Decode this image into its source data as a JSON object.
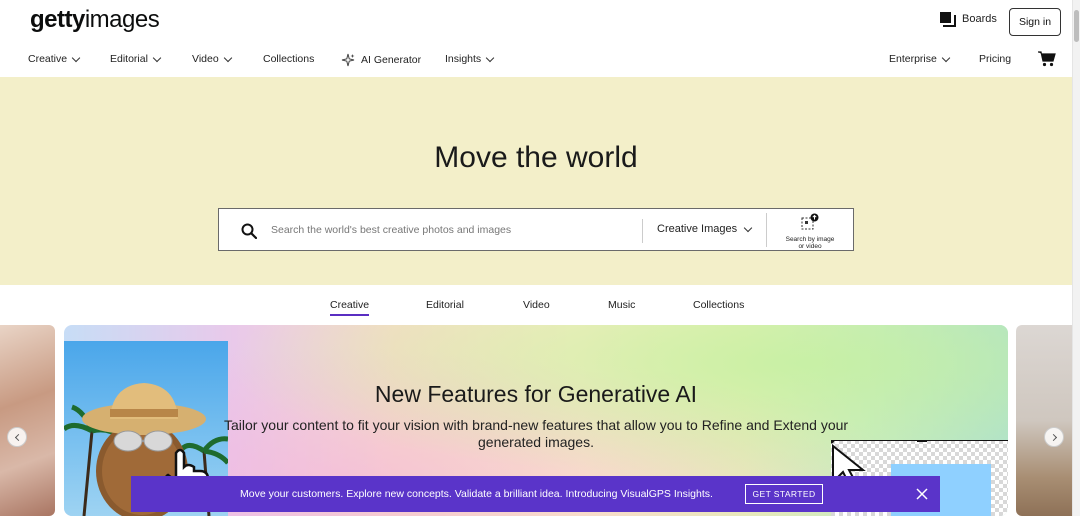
{
  "header": {
    "logo_bold": "getty",
    "logo_regular": "images",
    "boards_label": "Boards",
    "signin_label": "Sign in"
  },
  "nav": {
    "items": [
      {
        "label": "Creative",
        "dropdown": true
      },
      {
        "label": "Editorial",
        "dropdown": true
      },
      {
        "label": "Video",
        "dropdown": true
      },
      {
        "label": "Collections",
        "dropdown": false
      },
      {
        "label": "AI Generator",
        "dropdown": false,
        "icon": "sparkle-icon"
      },
      {
        "label": "Insights",
        "dropdown": true
      }
    ],
    "enterprise_label": "Enterprise",
    "pricing_label": "Pricing",
    "cart_icon": "cart-icon"
  },
  "hero": {
    "title": "Move the world",
    "search_placeholder": "Search the world's best creative photos and images",
    "search_type": "Creative Images",
    "search_by_image_line1": "Search by image",
    "search_by_image_line2": "or video",
    "background_color": "#f3efc9"
  },
  "tabs": [
    {
      "label": "Creative",
      "active": true
    },
    {
      "label": "Editorial",
      "active": false
    },
    {
      "label": "Video",
      "active": false
    },
    {
      "label": "Music",
      "active": false
    },
    {
      "label": "Collections",
      "active": false
    }
  ],
  "promo": {
    "title": "New Features for Generative AI",
    "description": "Tailor your content to fit your vision with brand-new features that allow you to Refine and Extend your generated images."
  },
  "banner": {
    "message": "Move your customers. Explore new concepts. Validate a brilliant idea. Introducing VisualGPS Insights.",
    "cta_label": "GET STARTED",
    "background_color": "#5a34c9"
  },
  "colors": {
    "accent": "#5a2ec2"
  }
}
